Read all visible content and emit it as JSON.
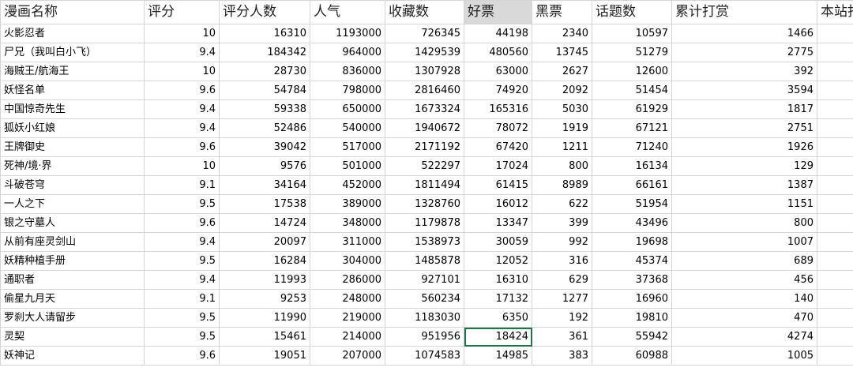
{
  "headers": [
    "漫画名称",
    "评分",
    "评分人数",
    "人气",
    "收藏数",
    "好票",
    "黑票",
    "话题数",
    "累计打赏",
    "本站打"
  ],
  "rows": [
    [
      "火影忍者",
      "10",
      "16310",
      "1193000",
      "726345",
      "44198",
      "2340",
      "10597",
      "1466"
    ],
    [
      "尸兄（我叫白小飞）",
      "9.4",
      "184342",
      "964000",
      "1429539",
      "480560",
      "13745",
      "51279",
      "2775"
    ],
    [
      "海贼王/航海王",
      "10",
      "28730",
      "836000",
      "1307928",
      "63000",
      "2627",
      "12600",
      "392"
    ],
    [
      "妖怪名单",
      "9.6",
      "54784",
      "798000",
      "2816460",
      "74920",
      "2092",
      "51454",
      "3594"
    ],
    [
      "中国惊奇先生",
      "9.4",
      "59338",
      "650000",
      "1673324",
      "165316",
      "5030",
      "61929",
      "1817"
    ],
    [
      "狐妖小红娘",
      "9.4",
      "52486",
      "540000",
      "1940672",
      "78072",
      "1919",
      "67121",
      "2751"
    ],
    [
      "王牌御史",
      "9.6",
      "39042",
      "517000",
      "2171192",
      "67420",
      "1211",
      "71240",
      "1926"
    ],
    [
      "死神/境·界",
      "10",
      "9576",
      "501000",
      "522297",
      "17024",
      "800",
      "16134",
      "129"
    ],
    [
      "斗破苍穹",
      "9.1",
      "34164",
      "452000",
      "1811494",
      "61415",
      "8989",
      "66161",
      "1387"
    ],
    [
      "一人之下",
      "9.5",
      "17538",
      "389000",
      "1328760",
      "16012",
      "622",
      "51954",
      "1151"
    ],
    [
      "银之守墓人",
      "9.6",
      "14724",
      "348000",
      "1179878",
      "13347",
      "399",
      "43496",
      "800"
    ],
    [
      "从前有座灵剑山",
      "9.4",
      "20097",
      "311000",
      "1538973",
      "30059",
      "992",
      "19698",
      "1007"
    ],
    [
      "妖精种植手册",
      "9.5",
      "16284",
      "304000",
      "1485878",
      "12052",
      "316",
      "45374",
      "689"
    ],
    [
      "通职者",
      "9.4",
      "11993",
      "286000",
      "927101",
      "16310",
      "629",
      "37368",
      "456"
    ],
    [
      "偷星九月天",
      "9.1",
      "9253",
      "248000",
      "560234",
      "17132",
      "1277",
      "16960",
      "140"
    ],
    [
      "罗刹大人请留步",
      "9.5",
      "11990",
      "219000",
      "1183030",
      "6350",
      "192",
      "19810",
      "470"
    ],
    [
      "灵契",
      "9.5",
      "15461",
      "214000",
      "951956",
      "18424",
      "361",
      "55942",
      "4274"
    ],
    [
      "妖神记",
      "9.6",
      "19051",
      "207000",
      "1074583",
      "14985",
      "383",
      "60988",
      "1005"
    ]
  ],
  "selection": {
    "row": 16,
    "col": 5
  }
}
